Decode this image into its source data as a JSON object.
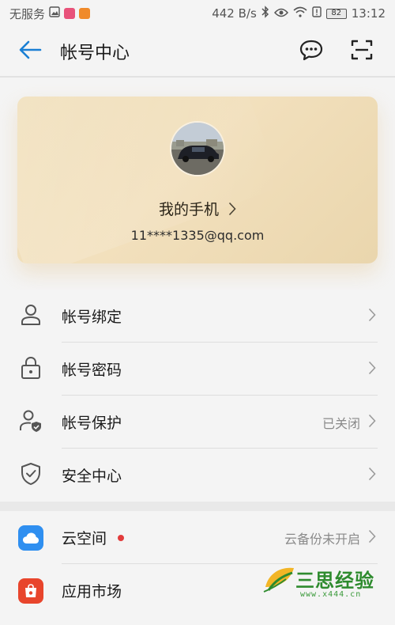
{
  "status_bar": {
    "carrier": "无服务",
    "network_speed": "442 B/s",
    "battery_level": "82",
    "time": "13:12"
  },
  "header": {
    "title": "帐号中心"
  },
  "profile": {
    "name": "我的手机",
    "email": "11****1335@qq.com"
  },
  "account_items": [
    {
      "label": "帐号绑定",
      "value": "",
      "icon": "person-icon"
    },
    {
      "label": "帐号密码",
      "value": "",
      "icon": "lock-icon"
    },
    {
      "label": "帐号保护",
      "value": "已关闭",
      "icon": "person-shield-icon"
    },
    {
      "label": "安全中心",
      "value": "",
      "icon": "shield-check-icon"
    }
  ],
  "service_items": [
    {
      "label": "云空间",
      "value": "云备份未开启",
      "icon": "cloud-icon",
      "badge": "red-dot"
    },
    {
      "label": "应用市场",
      "value": "",
      "icon": "app-market-icon"
    }
  ],
  "watermark": {
    "text": "三思经验",
    "url": "www.x444.cn"
  },
  "colors": {
    "accent": "#1a7fd4",
    "card_gold": "#efdcb4",
    "badge_red": "#e23b3b",
    "cloud_blue": "#2f8ff0",
    "market_red": "#e8452c"
  }
}
